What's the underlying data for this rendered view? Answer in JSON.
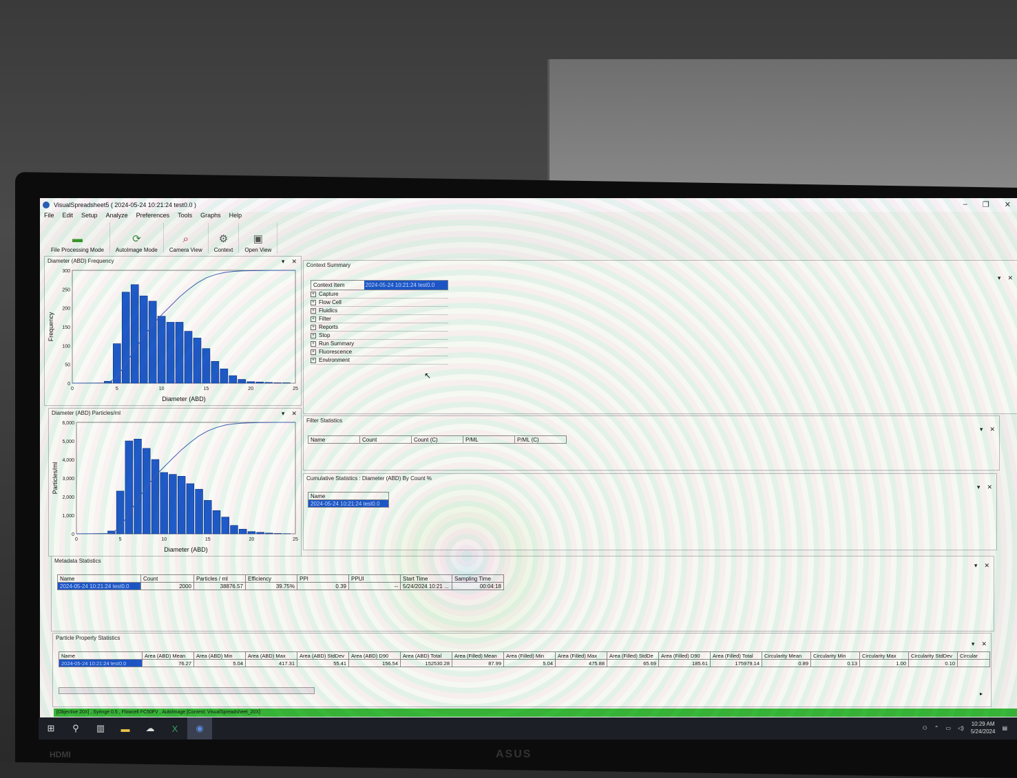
{
  "window": {
    "title": "VisualSpreadsheet5 ( 2024-05-24 10:21:24 test0.0 )",
    "minimize": "–",
    "restore": "❐",
    "close": "✕"
  },
  "menu": [
    "File",
    "Edit",
    "Setup",
    "Analyze",
    "Preferences",
    "Tools",
    "Graphs",
    "Help"
  ],
  "toolbar": [
    {
      "label": "File Processing Mode",
      "icon": "folder-icon"
    },
    {
      "label": "AutoImage Mode",
      "icon": "refresh-icon"
    },
    {
      "label": "Camera View",
      "icon": "magnifier-eye-icon"
    },
    {
      "label": "Context",
      "icon": "gear-icon"
    },
    {
      "label": "Open View",
      "icon": "monitor-icon"
    }
  ],
  "freq_panel": {
    "title": "Diameter (ABD) Frequency"
  },
  "ppm_panel": {
    "title": "Diameter (ABD) Particles/ml"
  },
  "chart_data": [
    {
      "type": "bar",
      "title": "Diameter (ABD) Frequency",
      "xlabel": "Diameter (ABD)",
      "ylabel": "Frequency",
      "xlim": [
        0,
        25
      ],
      "ylim": [
        0,
        300
      ],
      "xticks": [
        "0",
        "5",
        "10",
        "15",
        "20",
        "25"
      ],
      "yticks": [
        "0",
        "50",
        "100",
        "150",
        "200",
        "250",
        "300"
      ],
      "bar_width": 0.85,
      "x": [
        4,
        5,
        6,
        7,
        8,
        9,
        10,
        11,
        12,
        13,
        14,
        15,
        16,
        17,
        18,
        19,
        20,
        21,
        22,
        23,
        24
      ],
      "values": [
        5,
        105,
        242,
        262,
        232,
        218,
        178,
        162,
        162,
        138,
        120,
        92,
        58,
        38,
        20,
        10,
        4,
        3,
        2,
        1,
        1
      ],
      "cumulative_curve": true
    },
    {
      "type": "bar",
      "title": "Diameter (ABD) Particles/ml",
      "xlabel": "Diameter (ABD)",
      "ylabel": "Particles/ml",
      "xlim": [
        0,
        25
      ],
      "ylim": [
        0,
        6000
      ],
      "xticks": [
        "0",
        "5",
        "10",
        "15",
        "20",
        "25"
      ],
      "yticks": [
        "0",
        "1,000",
        "2,000",
        "3,000",
        "4,000",
        "5,000",
        "6,000"
      ],
      "bar_width": 0.85,
      "x": [
        4,
        5,
        6,
        7,
        8,
        9,
        10,
        11,
        12,
        13,
        14,
        15,
        16,
        17,
        18,
        19,
        20,
        21,
        22,
        23,
        24
      ],
      "values": [
        150,
        2300,
        5000,
        5100,
        4600,
        4000,
        3300,
        3200,
        3100,
        2700,
        2400,
        1800,
        1250,
        900,
        450,
        250,
        120,
        80,
        40,
        20,
        10
      ],
      "cumulative_curve": true
    }
  ],
  "context_summary": {
    "title": "Context Summary",
    "header_label": "Context Item",
    "header_value": "2024-05-24 10:21:24 test0.0",
    "items": [
      "Capture",
      "Flow Cell",
      "Fluidics",
      "Filter",
      "Reports",
      "Stop",
      "Run Summary",
      "Fluorescence",
      "Environment"
    ]
  },
  "filter_stats": {
    "title": "Filter Statistics",
    "columns": [
      "Name",
      "Count",
      "Count (C)",
      "P/ML",
      "P/ML (C)"
    ]
  },
  "cumulative_stats": {
    "title": "Cumulative Statistics : Diameter (ABD) By Count %",
    "columns": [
      "Name"
    ],
    "row": "2024-05-24 10:21:24 test0.0"
  },
  "metadata_stats": {
    "title": "Metadata Statistics",
    "columns": [
      "Name",
      "Count",
      "Particles / ml",
      "Efficiency",
      "PPI",
      "PPUI",
      "Start Time",
      "Sampling Time"
    ],
    "row": [
      "2024-05-24 10:21:24 test0.0",
      "2000",
      "38876.57",
      "39.75%",
      "0.39",
      "--",
      "5/24/2024 10:21 ...",
      "00:04:18"
    ]
  },
  "particle_stats": {
    "title": "Particle Property Statistics",
    "columns": [
      "Name",
      "Area (ABD) Mean",
      "Area (ABD) Min",
      "Area (ABD) Max",
      "Area (ABD) StdDev",
      "Area (ABD) D90",
      "Area (ABD) Total",
      "Area (Filled) Mean",
      "Area (Filled) Min",
      "Area (Filled) Max",
      "Area (Filled) StdDe",
      "Area (Filled) D90",
      "Area (Filled) Total",
      "Circularity Mean",
      "Circularity Min",
      "Circularity Max",
      "Circularity StdDev",
      "Circular"
    ],
    "row": [
      "2024-05-24 10:21:24 test0.0",
      "76.27",
      "5.04",
      "417.31",
      "55.41",
      "156.54",
      "152530.28",
      "87.99",
      "5.04",
      "475.88",
      "65.69",
      "185.61",
      "175979.14",
      "0.89",
      "0.13",
      "1.00",
      "0.10",
      ""
    ]
  },
  "status": "[Objective 20X] , Syringe 0.5 , Flowcell FC50FV , AutoImage [Context: VisualSpreadsheet_20X]",
  "taskbar": {
    "time": "10:29 AM",
    "date": "5/24/2024"
  },
  "monitor": {
    "brand": "ASUS",
    "port": "HDMI"
  }
}
